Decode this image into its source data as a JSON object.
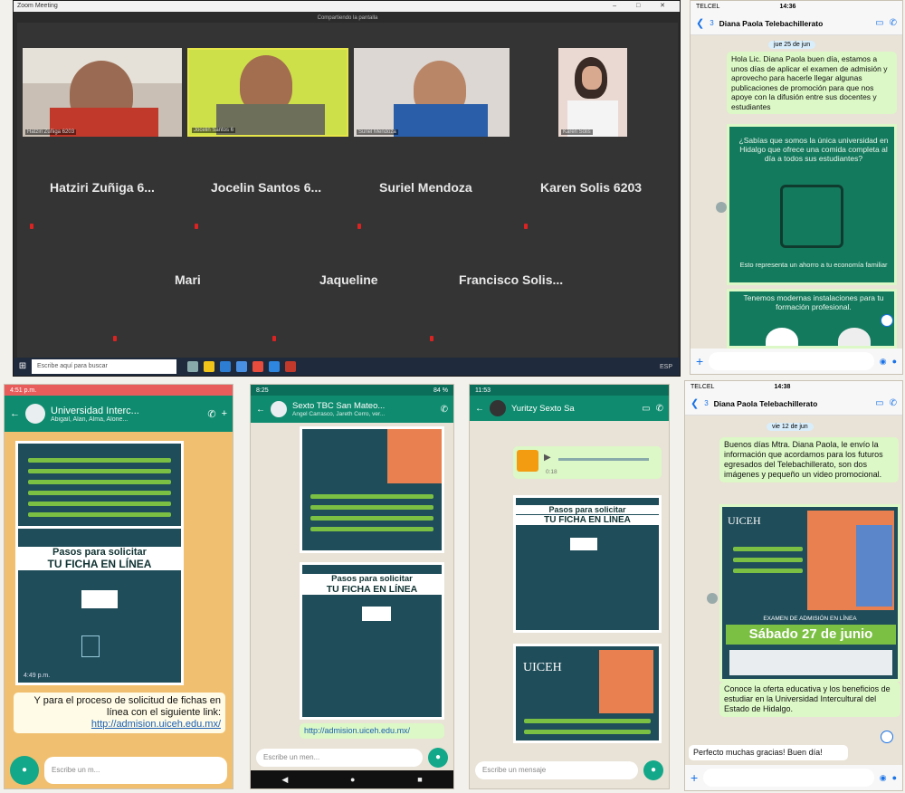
{
  "zoom": {
    "window_title": "Zoom Meeting",
    "meeting_banner": "Compartiendo la pantalla",
    "video_tiles": [
      {
        "caption": "Hatziri Zuñiga 6203"
      },
      {
        "caption": "Jocelin Santos 6"
      },
      {
        "caption": "Suriel Mendoza"
      },
      {
        "caption": "Karen Solis"
      }
    ],
    "names_row1": [
      "Hatziri Zuñiga 6...",
      "Jocelin Santos 6...",
      "Suriel Mendoza",
      "Karen Solis 6203"
    ],
    "names_row2": [
      "Mari",
      "Jaqueline",
      "Francisco Solis..."
    ],
    "taskbar": {
      "search_placeholder": "Escribe aquí para buscar",
      "tray": "ESP"
    }
  },
  "phone_top_right": {
    "carrier": "TELCEL",
    "time": "14:36",
    "back_count": "3",
    "contact": "Diana Paola Telebachillerato",
    "date_chip": "jue 25 de jun",
    "message": "Hola Lic. Diana Paola buen día, estamos a unos días de aplicar el examen de admisión y aprovecho para hacerle llegar algunas publicaciones de promoción para que nos apoye con la difusión entre sus docentes y estudiantes",
    "poster1_text": "¿Sabías que somos la única universidad en Hidalgo que ofrece una comida completa al día a todos sus estudiantes?",
    "poster1_foot": "Esto representa un ahorro a tu economía familiar",
    "poster2_text": "Tenemos modernas instalaciones para tu formación profesional."
  },
  "phone_bl1": {
    "time": "4:51 p.m.",
    "group": "Universidad Interc...",
    "members": "Abigail, Alan, Alma, Alone...",
    "poster_title1": "Pasos para solicitar",
    "poster_title2": "TU FICHA EN LÍNEA",
    "timestamp": "4:49 p.m.",
    "message": "Y para el proceso de solicitud de fichas en línea con el siguiente link:",
    "link": "http://admision.uiceh.edu.mx/",
    "composer_placeholder": "Escribe un m..."
  },
  "phone_bl2": {
    "time": "8:25",
    "battery": "84 %",
    "group": "Sexto TBC San Mateo...",
    "members": "Angel Carrasco, Jareth Cerro, ver...",
    "poster_title1": "Pasos para solicitar",
    "poster_title2": "TU FICHA EN LÍNEA",
    "link": "http://admision.uiceh.edu.mx/",
    "composer_placeholder": "Escribe un men..."
  },
  "phone_bl3": {
    "time": "11:53",
    "contact": "Yuritzy Sexto Sa",
    "audio_time": "0:18",
    "poster_title1": "Pasos para solicitar",
    "poster_title2": "TU FICHA EN LÍNEA",
    "poster3_brand": "UICEH",
    "composer_placeholder": "Escribe un mensaje"
  },
  "phone_br": {
    "carrier": "TELCEL",
    "time": "14:38",
    "back_count": "3",
    "contact": "Diana Paola Telebachillerato",
    "date_chip": "vie 12 de jun",
    "message": "Buenos días Mtra. Diana Paola, le envío la información que acordamos para los futuros egresados del Telebachillerato, son dos imágenes y pequeño un video promocional.",
    "poster_brand": "UICEH",
    "exam_banner": "EXAMEN DE ADMISIÓN EN LÍNEA",
    "exam_date": "Sábado 27 de junio",
    "message2": "Conoce la oferta educativa y los beneficios de estudiar en la Universidad Intercultural del Estado de Hidalgo.",
    "reply": "Perfecto muchas gracias! Buen día!"
  }
}
